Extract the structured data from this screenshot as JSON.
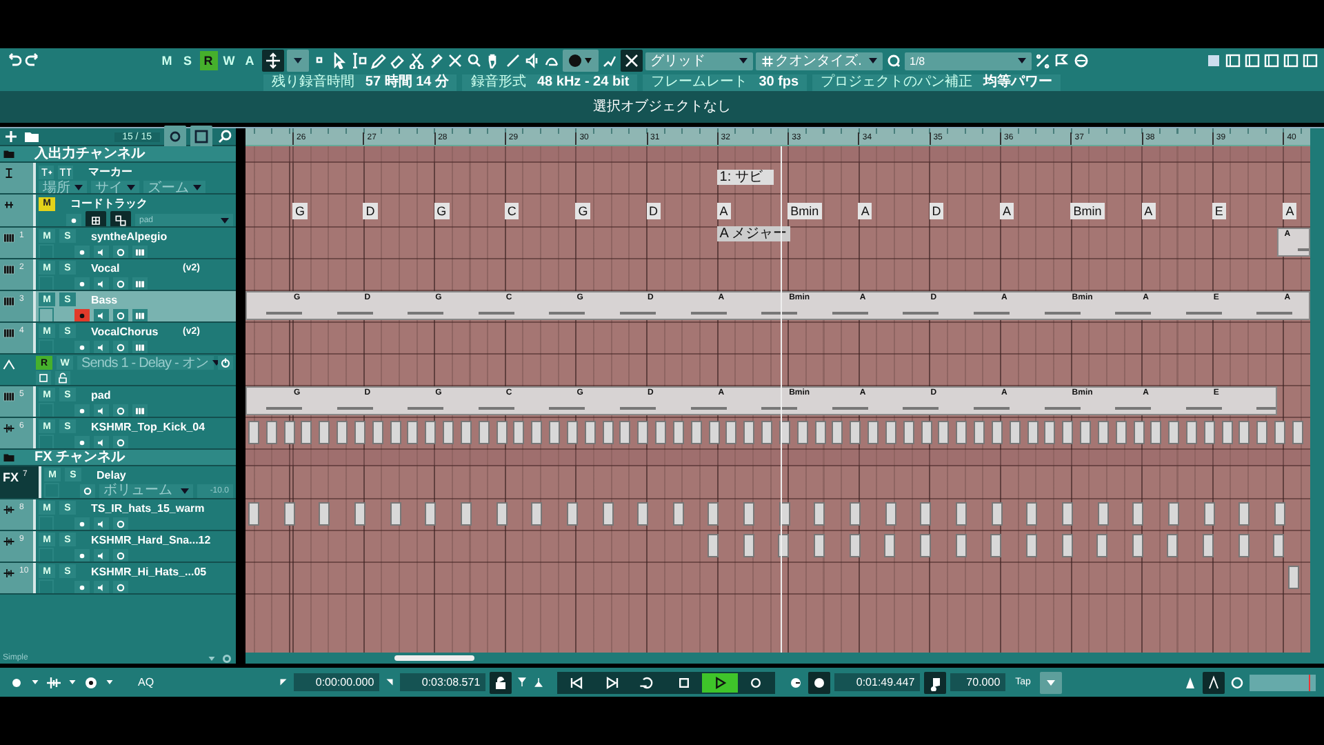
{
  "toolbar": {
    "automation_modes": [
      {
        "label": "M",
        "selected": false
      },
      {
        "label": "S",
        "selected": false
      },
      {
        "label": "R",
        "selected": true
      },
      {
        "label": "W",
        "selected": false
      },
      {
        "label": "A",
        "selected": false
      }
    ],
    "snap_type": "グリッド",
    "quantize_mode": "クオンタイズ.",
    "quantize_value": "1/8"
  },
  "status_line": [
    {
      "label": "残り録音時間",
      "value": "57 時間 14 分"
    },
    {
      "label": "録音形式",
      "value": "48 kHz - 24 bit"
    },
    {
      "label": "フレームレート",
      "value": "30 fps"
    },
    {
      "label": "プロジェクトのパン補正",
      "value": "均等パワー"
    }
  ],
  "info_line": "選択オブジェクトなし",
  "track_list": {
    "count": "15 / 15",
    "footer": "Simple",
    "tracks": [
      {
        "kind": "folder",
        "name": "入出力チャンネル"
      },
      {
        "kind": "marker",
        "name": "マーカー",
        "dropdowns": [
          "場所",
          "サイ",
          "ズーム"
        ]
      },
      {
        "kind": "chord",
        "name": "コードトラック",
        "mute": "M",
        "mute_on": true,
        "preset": "pad",
        "section": "1: サビ",
        "scale": "A メジャー",
        "chords": [
          "G",
          "D",
          "G",
          "C",
          "G",
          "D",
          "A",
          "Bmin",
          "A",
          "D",
          "A",
          "Bmin",
          "A",
          "E",
          "A"
        ]
      },
      {
        "kind": "instrument",
        "number": "1",
        "name": "syntheAlpegio",
        "mute": "M",
        "solo": "S",
        "selected": false,
        "record": false,
        "part": {
          "kind": "tail",
          "labels": [
            "A"
          ]
        }
      },
      {
        "kind": "instrument",
        "number": "2",
        "name": "Vocal",
        "version": "(v2)",
        "mute": "M",
        "solo": "S",
        "selected": false,
        "record": false
      },
      {
        "kind": "instrument",
        "number": "3",
        "name": "Bass",
        "mute": "M",
        "solo": "S",
        "selected": true,
        "record": true,
        "part": {
          "kind": "full",
          "labels": [
            "G",
            "D",
            "G",
            "C",
            "G",
            "D",
            "A",
            "Bmin",
            "A",
            "D",
            "A",
            "Bmin",
            "A",
            "E",
            "A"
          ]
        }
      },
      {
        "kind": "instrument",
        "number": "4",
        "name": "VocalChorus",
        "version": "(v2)",
        "mute": "M",
        "solo": "S",
        "selected": false,
        "record": false
      },
      {
        "kind": "automation",
        "read": "R",
        "read_on": true,
        "write": "W",
        "write_on": false,
        "parameter": "Sends 1 - Delay - オン"
      },
      {
        "kind": "instrument",
        "number": "5",
        "name": "pad",
        "mute": "M",
        "solo": "S",
        "selected": false,
        "record": false,
        "part": {
          "kind": "full",
          "labels": [
            "G",
            "D",
            "G",
            "C",
            "G",
            "D",
            "A",
            "Bmin",
            "A",
            "D",
            "A",
            "Bmin",
            "A",
            "E"
          ]
        }
      },
      {
        "kind": "audio",
        "number": "6",
        "name": "KSHMR_Top_Kick_04",
        "mute": "M",
        "solo": "S"
      },
      {
        "kind": "fx_folder",
        "name": "FX チャンネル"
      },
      {
        "kind": "fx",
        "label": "FX",
        "number": "7",
        "name": "Delay",
        "mute": "M",
        "solo": "S",
        "parameter": "ボリューム",
        "reading": "-10.0"
      },
      {
        "kind": "audio",
        "number": "8",
        "name": "TS_IR_hats_15_warm",
        "mute": "M",
        "solo": "S"
      },
      {
        "kind": "audio",
        "number": "9",
        "name": "KSHMR_Hard_Sna...12",
        "mute": "M",
        "solo": "S"
      },
      {
        "kind": "audio",
        "number": "10",
        "name": "KSHMR_Hi_Hats_...05",
        "mute": "M",
        "solo": "S"
      }
    ]
  },
  "ruler": {
    "bars": [
      "26",
      "27",
      "28",
      "29",
      "30",
      "31",
      "32",
      "33",
      "34",
      "35",
      "36",
      "37",
      "38",
      "39",
      "40"
    ]
  },
  "transport": {
    "quantize": "AQ",
    "left_locator": "0:00:00.000",
    "right_locator": "0:03:08.571",
    "position": "0:01:49.447",
    "tempo": "70.000",
    "tap": "Tap",
    "playing": true
  }
}
